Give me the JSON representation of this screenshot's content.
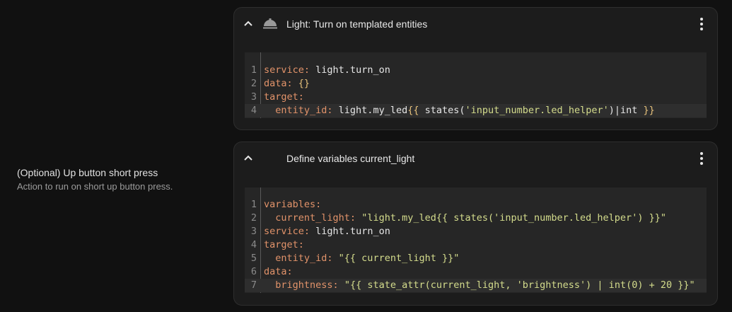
{
  "field": {
    "label": "(Optional) Up button short press",
    "description": "Action to run on short up button press."
  },
  "actions": [
    {
      "title": "Light: Turn on templated entities",
      "icon": "service-bell-icon",
      "code": [
        [
          {
            "t": "service",
            "c": "key"
          },
          {
            "t": ": ",
            "c": "key"
          },
          {
            "t": "light.turn_on",
            "c": "plain"
          }
        ],
        [
          {
            "t": "data",
            "c": "key"
          },
          {
            "t": ": ",
            "c": "key"
          },
          {
            "t": "{}",
            "c": "brace"
          }
        ],
        [
          {
            "t": "target",
            "c": "key"
          },
          {
            "t": ":",
            "c": "key"
          }
        ],
        [
          {
            "t": "  entity_id",
            "c": "key"
          },
          {
            "t": ": ",
            "c": "key"
          },
          {
            "t": "light.my_led",
            "c": "plain"
          },
          {
            "t": "{{",
            "c": "brace"
          },
          {
            "t": " states(",
            "c": "plain"
          },
          {
            "t": "'input_number.led_helper'",
            "c": "str"
          },
          {
            "t": ")|int ",
            "c": "plain"
          },
          {
            "t": "}}",
            "c": "brace"
          }
        ]
      ]
    },
    {
      "title": "Define variables current_light",
      "icon": "",
      "code": [
        [
          {
            "t": "variables",
            "c": "key"
          },
          {
            "t": ":",
            "c": "key"
          }
        ],
        [
          {
            "t": "  current_light",
            "c": "key"
          },
          {
            "t": ": ",
            "c": "key"
          },
          {
            "t": "\"light.my_led{{ states('input_number.led_helper') }}\"",
            "c": "str"
          }
        ],
        [
          {
            "t": "service",
            "c": "key"
          },
          {
            "t": ": ",
            "c": "key"
          },
          {
            "t": "light.turn_on",
            "c": "plain"
          }
        ],
        [
          {
            "t": "target",
            "c": "key"
          },
          {
            "t": ":",
            "c": "key"
          }
        ],
        [
          {
            "t": "  entity_id",
            "c": "key"
          },
          {
            "t": ": ",
            "c": "key"
          },
          {
            "t": "\"{{ current_light }}\"",
            "c": "str"
          }
        ],
        [
          {
            "t": "data",
            "c": "key"
          },
          {
            "t": ":",
            "c": "key"
          }
        ],
        [
          {
            "t": "  brightness",
            "c": "key"
          },
          {
            "t": ": ",
            "c": "key"
          },
          {
            "t": "\"{{ state_attr(current_light, 'brightness') | int(0) + 20 }}\"",
            "c": "str"
          }
        ]
      ]
    }
  ]
}
